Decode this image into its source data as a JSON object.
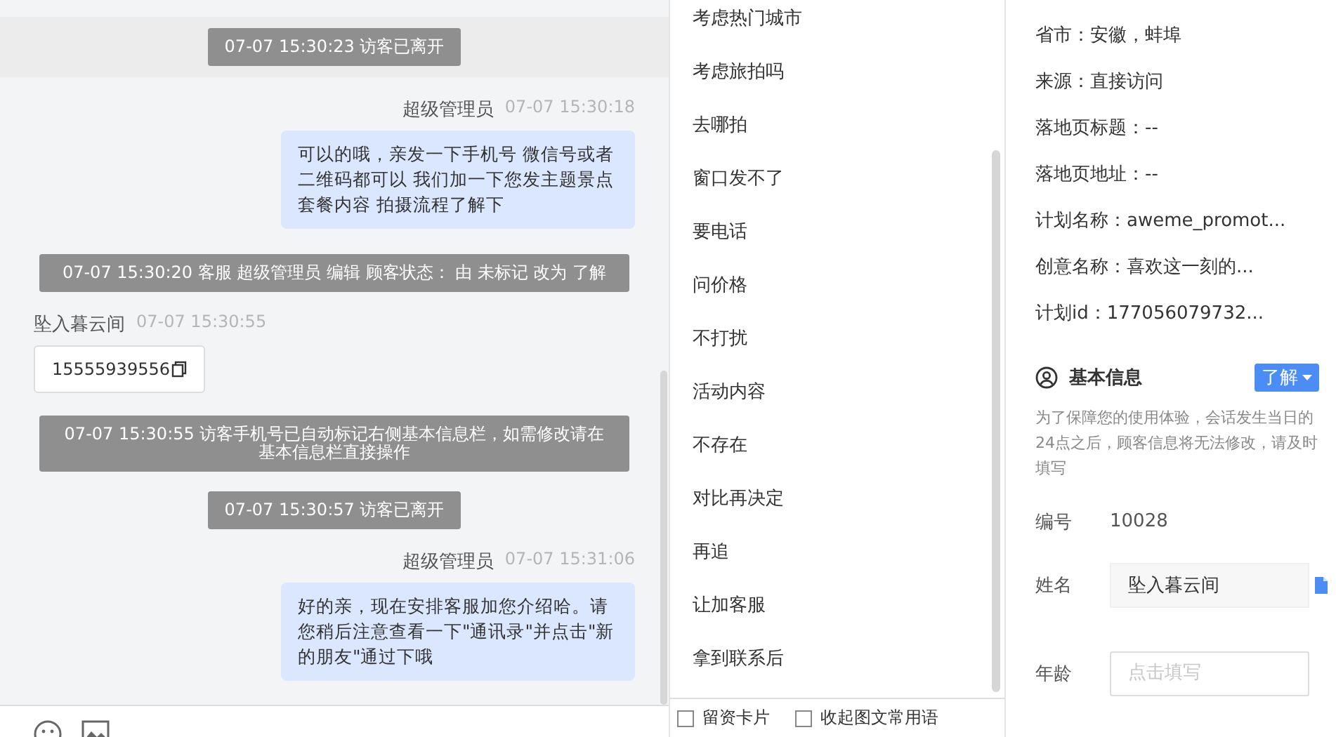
{
  "chat": {
    "messages": [
      {
        "kind": "system",
        "text": "07-07 15:30:23 访客已离开",
        "highlighted": true
      },
      {
        "kind": "agent",
        "name": "超级管理员",
        "time": "07-07 15:30:18",
        "text": "可以的哦，亲发一下手机号 微信号或者二维码都可以 我们加一下您发主题景点套餐内容 拍摄流程了解下"
      },
      {
        "kind": "system",
        "text": "07-07 15:30:20 客服 超级管理员 编辑 顾客状态： 由 未标记 改为 了解",
        "highlighted": false
      },
      {
        "kind": "visitor",
        "name": "坠入暮云间",
        "time": "07-07 15:30:55",
        "text": "15555939556"
      },
      {
        "kind": "system",
        "text": "07-07 15:30:55 访客手机号已自动标记右侧基本信息栏，如需修改请在基本信息栏直接操作",
        "highlighted": false
      },
      {
        "kind": "system",
        "text": "07-07 15:30:57 访客已离开",
        "highlighted": false
      },
      {
        "kind": "agent",
        "name": "超级管理员",
        "time": "07-07 15:31:06",
        "text": "好的亲，现在安排客服加您介绍哈。请您稍后注意查看一下\"通讯录\"并点击\"新的朋友\"通过下哦"
      }
    ]
  },
  "phrases": {
    "items": [
      "考虑热门城市",
      "考虑旅拍吗",
      "去哪拍",
      "窗口发不了",
      "要电话",
      "问价格",
      "不打扰",
      "活动内容",
      "不存在",
      "对比再决定",
      "再追",
      "让加客服",
      "拿到联系后"
    ],
    "footer": [
      {
        "label": "留资卡片",
        "checked": false
      },
      {
        "label": "收起图文常用语",
        "checked": false
      }
    ]
  },
  "info": {
    "details": [
      "省市：安徽，蚌埠",
      "来源：直接访问",
      "落地页标题：--",
      "落地页地址：--",
      "计划名称：aweme_promot...",
      "创意名称：喜欢这一刻的...",
      "计划id：177056079732..."
    ],
    "section_title": "基本信息",
    "status_button": "了解",
    "notice": "为了保障您的使用体验，会话发生当日的24点之后，顾客信息将无法修改，请及时填写",
    "fields": [
      {
        "kind": "text",
        "label": "编号",
        "value": "10028"
      },
      {
        "kind": "filled",
        "label": "姓名",
        "value": "坠入暮云间"
      },
      {
        "kind": "input",
        "label": "年龄",
        "placeholder": "点击填写"
      }
    ]
  }
}
